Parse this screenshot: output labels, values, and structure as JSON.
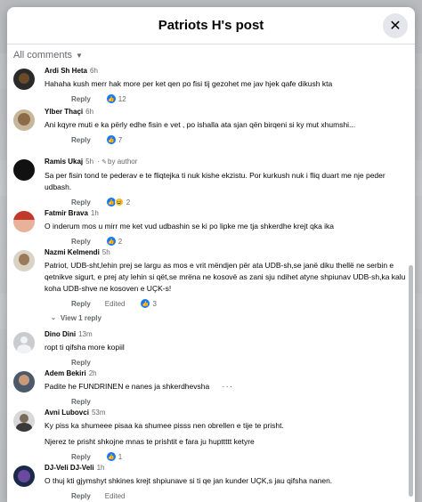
{
  "modal": {
    "title": "Patriots H's post",
    "close_glyph": "✕",
    "sort_label": "All comments"
  },
  "actions_labels": {
    "reply": "Reply",
    "edited": "Edited"
  },
  "comments": [
    {
      "author": "Ardi Sh Heta",
      "time": "6h",
      "text": "Hahaha kush merr hak more per ket qen po fisi tij gezohet me jav hjek qafe dikush kta",
      "reactions": "12"
    },
    {
      "author": "Ylber Thaçi",
      "time": "6h",
      "text": "Ani kqyre muti e ka përly edhe fisin e vet , po ishalla ata sjan qën birqeni si ky mut xhumshi...",
      "reactions": "7"
    },
    {
      "author": "Ramis Ukaj",
      "time": "5h",
      "badge": "by author",
      "text": "Sa per fisin tond te pederav e te fliqtejka ti nuk kishe ekzistu. Por kurkush nuk i fliq duart me nje peder udbash.",
      "reactions": "2"
    },
    {
      "author": "Fatmir Brava",
      "time": "1h",
      "text": "O inderum mos u mirr me ket vud udbashin se ki po lipke me tja shkerdhe krejt qka ika",
      "reactions": "2"
    },
    {
      "author": "Nazmi Kelmendi",
      "time": "5h",
      "text": "Patriot, UDB-sht,lehin prej se largu as mos e vrit mëndjen për ata UDB-sh,se janë diku thellë ne serbin e qetnikve sigurt, e prej aty lehin si qët,se mrëna ne kosovë as zani sju ndihet atyne shpiunav UDB-sh,ka kalu koha UDB-shve ne kosoven e UÇK-s!",
      "reactions": "3",
      "view_replies": "View 1 reply"
    },
    {
      "author": "Dino Dini",
      "time": "13m",
      "text": "ropt ti qifsha more kopiil"
    },
    {
      "author": "Adem Bekiri",
      "time": "2h",
      "text": "Padite he FUNDRINEN e nanes ja shkerdhevsha",
      "more": "···"
    },
    {
      "author": "Avni Lubovci",
      "time": "53m",
      "text": "Ky piss ka shumeee pisaa ka shumee pisss nen obrellen e tije te prisht.",
      "text2": "Njerez te prisht shkojne mnas te prishtit e fara ju hupttttt ketyre",
      "reactions": "1"
    },
    {
      "author": "DJ-Veli DJ-Veli",
      "time": "1h",
      "text": "O thuj kti gjymshyt shkines krejt shpiunave si ti qe jan kunder UÇK,s jau qifsha nanen."
    }
  ],
  "icons": {
    "like": "like-icon",
    "haha": "haha-icon",
    "close": "close-icon",
    "caret": "chevron-down-icon"
  },
  "colors": {
    "accent": "#1877f2",
    "muted": "#65676b",
    "haha": "#f7b928"
  }
}
